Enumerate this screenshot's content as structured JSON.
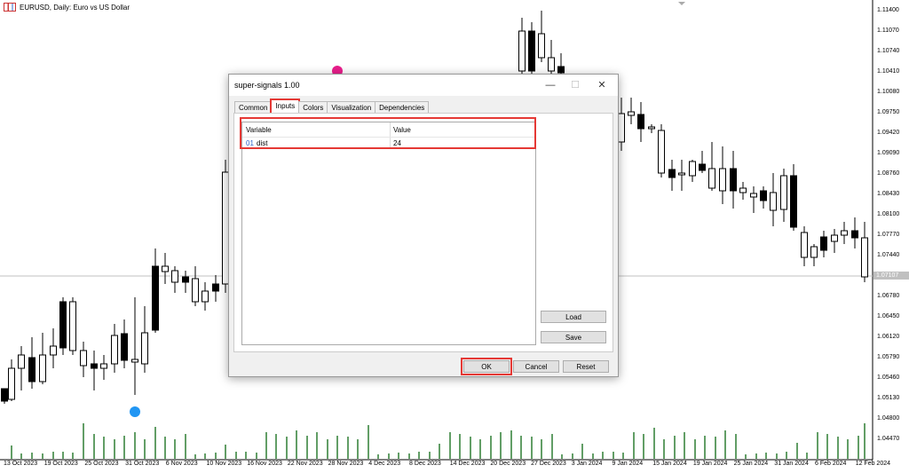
{
  "chart": {
    "title": "EURUSD, Daily: Euro vs US Dollar",
    "bid_price": "1.07107",
    "price_labels": [
      "1.11400",
      "1.11070",
      "1.10740",
      "1.10410",
      "1.10080",
      "1.09750",
      "1.09420",
      "1.09090",
      "1.08760",
      "1.08430",
      "1.08100",
      "1.07770",
      "1.07440",
      "1.07110",
      "1.06780",
      "1.06450",
      "1.06120",
      "1.05790",
      "1.05460",
      "1.05130",
      "1.04800",
      "1.04470"
    ],
    "date_labels": [
      "13 Oct 2023",
      "19 Oct 2023",
      "25 Oct 2023",
      "31 Oct 2023",
      "6 Nov 2023",
      "10 Nov 2023",
      "16 Nov 2023",
      "22 Nov 2023",
      "28 Nov 2023",
      "4 Dec 2023",
      "8 Dec 2023",
      "14 Dec 2023",
      "20 Dec 2023",
      "27 Dec 2023",
      "3 Jan 2024",
      "9 Jan 2024",
      "15 Jan 2024",
      "19 Jan 2024",
      "25 Jan 2024",
      "31 Jan 2024",
      "6 Feb 2024",
      "12 Feb 2024"
    ],
    "colors": {
      "up_fill": "#ffffff",
      "down_fill": "#000000",
      "volume": "#2e7d32",
      "buy_signal": "#2196f3",
      "sell_signal": "#e91e8c"
    }
  },
  "dialog": {
    "title": "super-signals 1.00",
    "window_buttons": {
      "minimize": "—",
      "maximize": "☐",
      "close": "✕"
    },
    "tabs": [
      "Common",
      "Inputs",
      "Colors",
      "Visualization",
      "Dependencies"
    ],
    "active_tab": "Inputs",
    "table": {
      "headers": [
        "Variable",
        "Value"
      ],
      "rows": [
        {
          "index": "01",
          "variable": "dist",
          "value": "24"
        }
      ]
    },
    "side_buttons": {
      "load": "Load",
      "save": "Save"
    },
    "footer_buttons": {
      "ok": "OK",
      "cancel": "Cancel",
      "reset": "Reset"
    }
  }
}
